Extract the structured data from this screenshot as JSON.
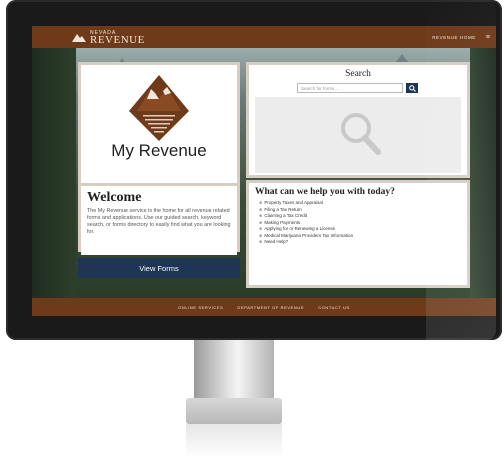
{
  "header": {
    "logo_small": "NEVADA",
    "logo_big": "REVENUE",
    "nav_home": "REVENUE HOME",
    "menu_icon": "hamburger-icon"
  },
  "brand": {
    "title": "My Revenue",
    "logo_icon": "mountain-logo-icon"
  },
  "welcome": {
    "title": "Welcome",
    "text": "The My Revenue service is the home for all revenue related forms and applications. Use our guided search, keyword search, or forms directory to easily find what you are looking for."
  },
  "actions": {
    "view_forms": "View Forms"
  },
  "search": {
    "title": "Search",
    "placeholder": "Search for forms...",
    "button_icon": "search-icon",
    "panel_icon": "magnifier-icon"
  },
  "help": {
    "title": "What can we help you with today?",
    "items": [
      "Property Taxes and Appraisal",
      "Filing a Tax Return",
      "Claiming a Tax Credit",
      "Making Payments",
      "Applying for or Renewing a License",
      "Medical Marijuana Providers Tax Information",
      "Need Help?"
    ]
  },
  "footer": {
    "links": [
      "ONLINE SERVICES",
      "DEPARTMENT OF REVENUE",
      "CONTACT US"
    ]
  },
  "colors": {
    "brand_brown": "#6f3a1a",
    "navy": "#1e3553",
    "card_border": "#d7cdc2"
  }
}
